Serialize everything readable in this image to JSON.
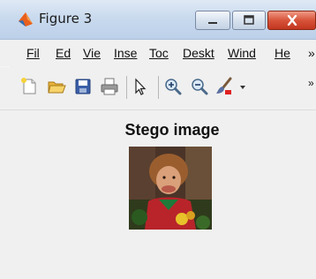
{
  "window": {
    "title": "Figure 3"
  },
  "menu": {
    "items": [
      {
        "label": "Fil",
        "underline": "F"
      },
      {
        "label": "Ed",
        "underline": "E"
      },
      {
        "label": "Vie",
        "underline": "V"
      },
      {
        "label": "Inse",
        "underline": "I"
      },
      {
        "label": "Toc",
        "underline": "T"
      },
      {
        "label": "Deskt",
        "underline": "D"
      },
      {
        "label": "Wind",
        "underline": "W"
      },
      {
        "label": "He",
        "underline": "H"
      }
    ],
    "overflow": "»"
  },
  "toolbar": {
    "icons": [
      "new-figure-icon",
      "open-file-icon",
      "save-icon",
      "print-icon",
      "pointer-icon",
      "zoom-in-icon",
      "zoom-out-icon",
      "brush-icon"
    ],
    "overflow": "»"
  },
  "figure": {
    "title": "Stego image"
  },
  "colors": {
    "titlebar": "#c9daee",
    "close_button": "#d8533a",
    "background": "#f0f0f0"
  }
}
